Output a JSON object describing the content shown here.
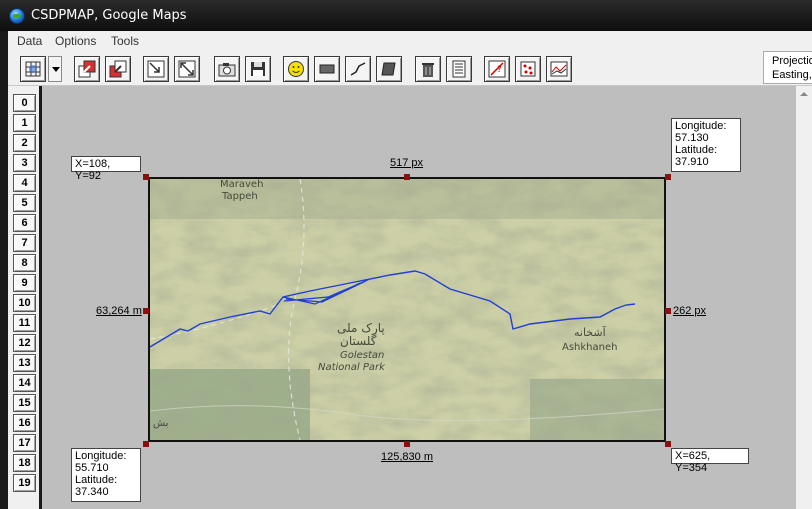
{
  "window": {
    "title": "CSDPMAP, Google Maps"
  },
  "menu": {
    "items": [
      "Data",
      "Options",
      "Tools"
    ]
  },
  "toolbar": {
    "projection_box": {
      "line1": "Projectio",
      "line2": "Easting, "
    }
  },
  "rows": [
    "0",
    "1",
    "2",
    "3",
    "4",
    "5",
    "6",
    "7",
    "8",
    "9",
    "10",
    "11",
    "12",
    "13",
    "14",
    "15",
    "16",
    "17",
    "18",
    "19"
  ],
  "map": {
    "top_left_label": "X=108, Y=92",
    "top_width_label": "517 px",
    "top_right_coord": {
      "lon_label": "Longitude:",
      "lon": "57.130",
      "lat_label": "Latitude:",
      "lat": "37.910"
    },
    "left_distance_label": "63,264 m",
    "right_height_label": "262 px",
    "bottom_distance_label": "125,830 m",
    "bottom_right_label": "X=625, Y=354",
    "bottom_left_coord": {
      "lon_label": "Longitude:",
      "lon": "55.710",
      "lat_label": "Latitude:",
      "lat": "37.340"
    },
    "place_labels": {
      "maraveh_1": "Maraveh",
      "maraveh_2": "Tappeh",
      "golestan_fa_1": "پارک ملی",
      "golestan_fa_2": "گلستان",
      "golestan_1": "Golestan",
      "golestan_2": "National Park",
      "ashkhaneh_fa": "آشخانه",
      "ashkhaneh": "Ashkhaneh",
      "corner_fa": "بش"
    },
    "colors": {
      "route": "#1f3fd6",
      "terrain": "#c9cc9f"
    }
  }
}
